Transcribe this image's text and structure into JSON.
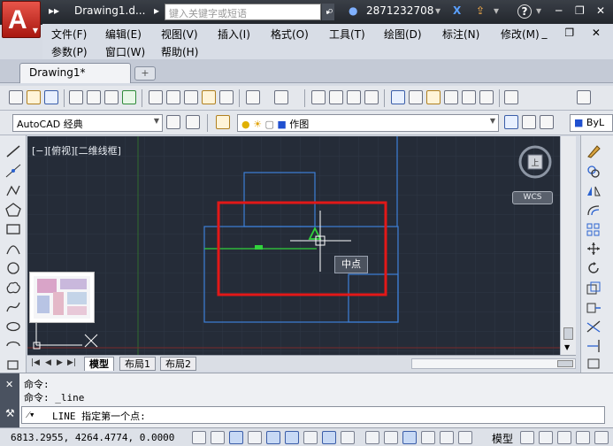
{
  "window": {
    "logo_letter": "A",
    "quick_nav": "▸▸",
    "doc_title": "Drawing1.d...",
    "title_arrow": "▸",
    "search_placeholder": "键入关键字或短语",
    "search_go": "▸",
    "user_id": "2871232708",
    "help": "?"
  },
  "menu": {
    "items": [
      "文件(F)",
      "编辑(E)",
      "视图(V)",
      "插入(I)",
      "格式(O)",
      "工具(T)",
      "绘图(D)",
      "标注(N)",
      "修改(M)",
      "参数(P)",
      "窗口(W)",
      "帮助(H)"
    ],
    "window_controls": "_ ❐ ✕"
  },
  "tabs": {
    "drawing_tab": "Drawing1*",
    "new_tab": "+"
  },
  "toolbar2": {
    "workspace": "AutoCAD 经典",
    "layer": "作图",
    "layer_right": "ByL"
  },
  "viewport": {
    "label": "[−][俯视][二维线框]",
    "wcs": "WCS",
    "cube_face": "上",
    "tooltip": "中点"
  },
  "layout_tabs": [
    "模型",
    "布局1",
    "布局2"
  ],
  "command": {
    "history": [
      "命令:",
      "命令:  _line"
    ],
    "prompt": "LINE 指定第一个点:"
  },
  "status": {
    "coords": "6813.2955,   4264.4774, 0.0000",
    "model": "模型"
  },
  "colors": {
    "canvas_bg": "#252c38",
    "shape_blue": "#3d7fd8",
    "shape_green": "#31d23c",
    "highlight_red": "#e21818"
  }
}
